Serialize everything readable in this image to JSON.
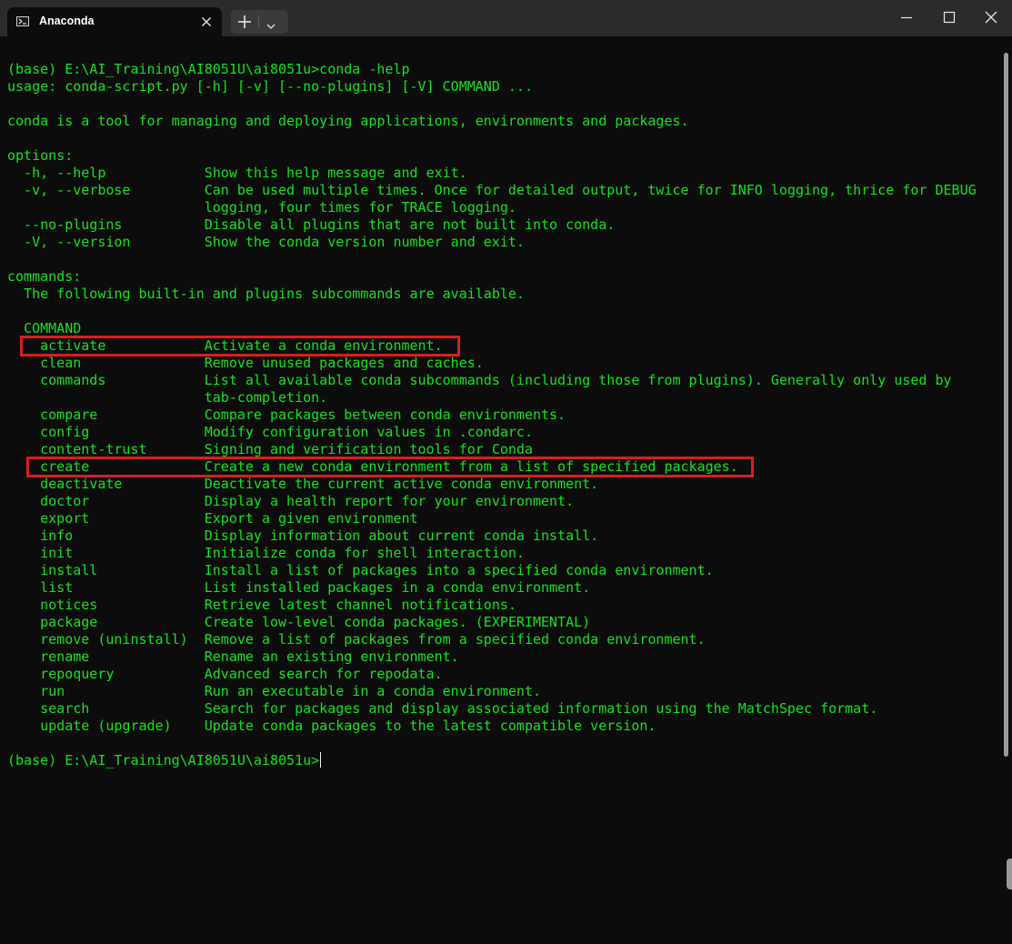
{
  "window": {
    "tab_title": "Anaconda",
    "icons": {
      "tab": "terminal-icon",
      "close_tab": "close-icon",
      "new_tab": "plus-icon",
      "dropdown": "chevron-down-icon",
      "minimize": "minimize-icon",
      "maximize": "maximize-icon",
      "close_window": "close-icon"
    }
  },
  "colors": {
    "terminal_text": "#13e31c",
    "terminal_background": "#0c0c0c",
    "highlight_box": "#d81e1e",
    "titlebar": "#2b2b2b"
  },
  "terminal": {
    "lines": [
      "(base) E:\\AI_Training\\AI8051U\\ai8051u>conda -help",
      "usage: conda-script.py [-h] [-v] [--no-plugins] [-V] COMMAND ...",
      "",
      "conda is a tool for managing and deploying applications, environments and packages.",
      "",
      "options:",
      "  -h, --help            Show this help message and exit.",
      "  -v, --verbose         Can be used multiple times. Once for detailed output, twice for INFO logging, thrice for DEBUG",
      "                        logging, four times for TRACE logging.",
      "  --no-plugins          Disable all plugins that are not built into conda.",
      "  -V, --version         Show the conda version number and exit.",
      "",
      "commands:",
      "  The following built-in and plugins subcommands are available.",
      "",
      "  COMMAND",
      "    activate            Activate a conda environment.",
      "    clean               Remove unused packages and caches.",
      "    commands            List all available conda subcommands (including those from plugins). Generally only used by",
      "                        tab-completion.",
      "    compare             Compare packages between conda environments.",
      "    config              Modify configuration values in .condarc.",
      "    content-trust       Signing and verification tools for Conda",
      "    create              Create a new conda environment from a list of specified packages.",
      "    deactivate          Deactivate the current active conda environment.",
      "    doctor              Display a health report for your environment.",
      "    export              Export a given environment",
      "    info                Display information about current conda install.",
      "    init                Initialize conda for shell interaction.",
      "    install             Install a list of packages into a specified conda environment.",
      "    list                List installed packages in a conda environment.",
      "    notices             Retrieve latest channel notifications.",
      "    package             Create low-level conda packages. (EXPERIMENTAL)",
      "    remove (uninstall)  Remove a list of packages from a specified conda environment.",
      "    rename              Rename an existing environment.",
      "    repoquery           Advanced search for repodata.",
      "    run                 Run an executable in a conda environment.",
      "    search              Search for packages and display associated information using the MatchSpec format.",
      "    update (upgrade)    Update conda packages to the latest compatible version.",
      "",
      "(base) E:\\AI_Training\\AI8051U\\ai8051u>"
    ],
    "highlighted_commands": [
      "activate",
      "create"
    ]
  }
}
